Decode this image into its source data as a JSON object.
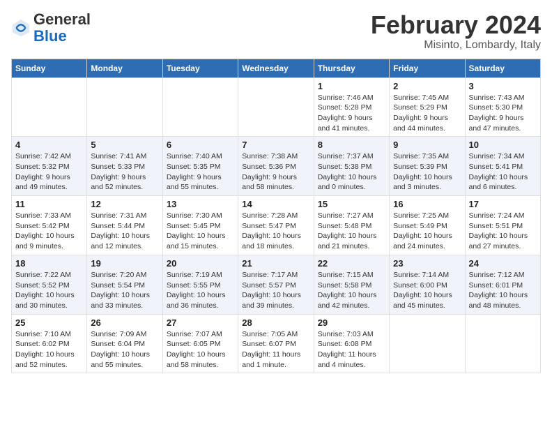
{
  "header": {
    "logo_general": "General",
    "logo_blue": "Blue",
    "title": "February 2024",
    "subtitle": "Misinto, Lombardy, Italy"
  },
  "calendar": {
    "days_of_week": [
      "Sunday",
      "Monday",
      "Tuesday",
      "Wednesday",
      "Thursday",
      "Friday",
      "Saturday"
    ],
    "weeks": [
      [
        {
          "day": "",
          "info": ""
        },
        {
          "day": "",
          "info": ""
        },
        {
          "day": "",
          "info": ""
        },
        {
          "day": "",
          "info": ""
        },
        {
          "day": "1",
          "info": "Sunrise: 7:46 AM\nSunset: 5:28 PM\nDaylight: 9 hours\nand 41 minutes."
        },
        {
          "day": "2",
          "info": "Sunrise: 7:45 AM\nSunset: 5:29 PM\nDaylight: 9 hours\nand 44 minutes."
        },
        {
          "day": "3",
          "info": "Sunrise: 7:43 AM\nSunset: 5:30 PM\nDaylight: 9 hours\nand 47 minutes."
        }
      ],
      [
        {
          "day": "4",
          "info": "Sunrise: 7:42 AM\nSunset: 5:32 PM\nDaylight: 9 hours\nand 49 minutes."
        },
        {
          "day": "5",
          "info": "Sunrise: 7:41 AM\nSunset: 5:33 PM\nDaylight: 9 hours\nand 52 minutes."
        },
        {
          "day": "6",
          "info": "Sunrise: 7:40 AM\nSunset: 5:35 PM\nDaylight: 9 hours\nand 55 minutes."
        },
        {
          "day": "7",
          "info": "Sunrise: 7:38 AM\nSunset: 5:36 PM\nDaylight: 9 hours\nand 58 minutes."
        },
        {
          "day": "8",
          "info": "Sunrise: 7:37 AM\nSunset: 5:38 PM\nDaylight: 10 hours\nand 0 minutes."
        },
        {
          "day": "9",
          "info": "Sunrise: 7:35 AM\nSunset: 5:39 PM\nDaylight: 10 hours\nand 3 minutes."
        },
        {
          "day": "10",
          "info": "Sunrise: 7:34 AM\nSunset: 5:41 PM\nDaylight: 10 hours\nand 6 minutes."
        }
      ],
      [
        {
          "day": "11",
          "info": "Sunrise: 7:33 AM\nSunset: 5:42 PM\nDaylight: 10 hours\nand 9 minutes."
        },
        {
          "day": "12",
          "info": "Sunrise: 7:31 AM\nSunset: 5:44 PM\nDaylight: 10 hours\nand 12 minutes."
        },
        {
          "day": "13",
          "info": "Sunrise: 7:30 AM\nSunset: 5:45 PM\nDaylight: 10 hours\nand 15 minutes."
        },
        {
          "day": "14",
          "info": "Sunrise: 7:28 AM\nSunset: 5:47 PM\nDaylight: 10 hours\nand 18 minutes."
        },
        {
          "day": "15",
          "info": "Sunrise: 7:27 AM\nSunset: 5:48 PM\nDaylight: 10 hours\nand 21 minutes."
        },
        {
          "day": "16",
          "info": "Sunrise: 7:25 AM\nSunset: 5:49 PM\nDaylight: 10 hours\nand 24 minutes."
        },
        {
          "day": "17",
          "info": "Sunrise: 7:24 AM\nSunset: 5:51 PM\nDaylight: 10 hours\nand 27 minutes."
        }
      ],
      [
        {
          "day": "18",
          "info": "Sunrise: 7:22 AM\nSunset: 5:52 PM\nDaylight: 10 hours\nand 30 minutes."
        },
        {
          "day": "19",
          "info": "Sunrise: 7:20 AM\nSunset: 5:54 PM\nDaylight: 10 hours\nand 33 minutes."
        },
        {
          "day": "20",
          "info": "Sunrise: 7:19 AM\nSunset: 5:55 PM\nDaylight: 10 hours\nand 36 minutes."
        },
        {
          "day": "21",
          "info": "Sunrise: 7:17 AM\nSunset: 5:57 PM\nDaylight: 10 hours\nand 39 minutes."
        },
        {
          "day": "22",
          "info": "Sunrise: 7:15 AM\nSunset: 5:58 PM\nDaylight: 10 hours\nand 42 minutes."
        },
        {
          "day": "23",
          "info": "Sunrise: 7:14 AM\nSunset: 6:00 PM\nDaylight: 10 hours\nand 45 minutes."
        },
        {
          "day": "24",
          "info": "Sunrise: 7:12 AM\nSunset: 6:01 PM\nDaylight: 10 hours\nand 48 minutes."
        }
      ],
      [
        {
          "day": "25",
          "info": "Sunrise: 7:10 AM\nSunset: 6:02 PM\nDaylight: 10 hours\nand 52 minutes."
        },
        {
          "day": "26",
          "info": "Sunrise: 7:09 AM\nSunset: 6:04 PM\nDaylight: 10 hours\nand 55 minutes."
        },
        {
          "day": "27",
          "info": "Sunrise: 7:07 AM\nSunset: 6:05 PM\nDaylight: 10 hours\nand 58 minutes."
        },
        {
          "day": "28",
          "info": "Sunrise: 7:05 AM\nSunset: 6:07 PM\nDaylight: 11 hours\nand 1 minute."
        },
        {
          "day": "29",
          "info": "Sunrise: 7:03 AM\nSunset: 6:08 PM\nDaylight: 11 hours\nand 4 minutes."
        },
        {
          "day": "",
          "info": ""
        },
        {
          "day": "",
          "info": ""
        }
      ]
    ],
    "week_row_classes": [
      "row-week1",
      "row-week2",
      "row-week3",
      "row-week4",
      "row-week5"
    ]
  }
}
